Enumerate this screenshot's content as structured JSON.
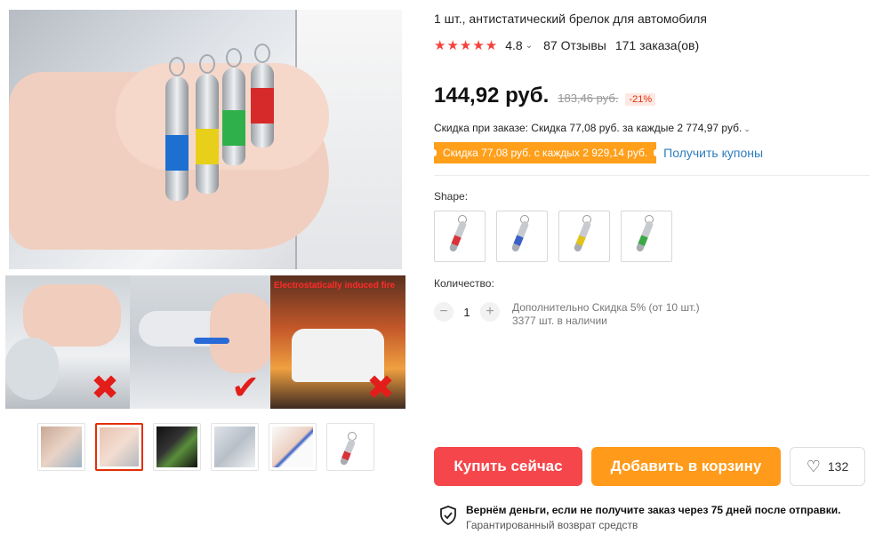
{
  "product": {
    "title": "1 шт., антистатический брелок для автомобиля",
    "rating": "4.8",
    "reviews": "87 Отзывы",
    "orders": "171 заказа(ов)",
    "price": "144,92 руб.",
    "old_price": "183,46 руб.",
    "discount": "-21%",
    "order_discount": "Скидка при заказе: Скидка 77,08 руб. за каждые 2 774,97 руб.",
    "coupon_badge": "Скидка 77,08 руб. с каждых 2 929,14 руб.",
    "coupon_link": "Получить купоны"
  },
  "gallery": {
    "fire_caption": "Electrostatically induced fire"
  },
  "options": {
    "shape_label": "Shape:",
    "shapes": [
      {
        "color": "#d8333a"
      },
      {
        "color": "#3a5fc8"
      },
      {
        "color": "#e2c21a"
      },
      {
        "color": "#3aa845"
      }
    ]
  },
  "quantity": {
    "label": "Количество:",
    "minus": "−",
    "plus": "+",
    "value": "1",
    "extra_discount": "Дополнительно Скидка 5% (от 10 шт.)",
    "stock": "3377 шт. в наличии"
  },
  "actions": {
    "buy_now": "Купить сейчас",
    "add_to_cart": "Добавить в корзину",
    "wishlist_count": "132"
  },
  "guarantee": {
    "title": "Вернём деньги, если не получите заказ через 75 дней после отправки.",
    "subtitle": "Гарантированный возврат средств"
  },
  "colors": {
    "accent_red": "#f5474b",
    "accent_orange": "#ff9a1a",
    "link_blue": "#2e7dbe",
    "star_red": "#f5413d"
  }
}
